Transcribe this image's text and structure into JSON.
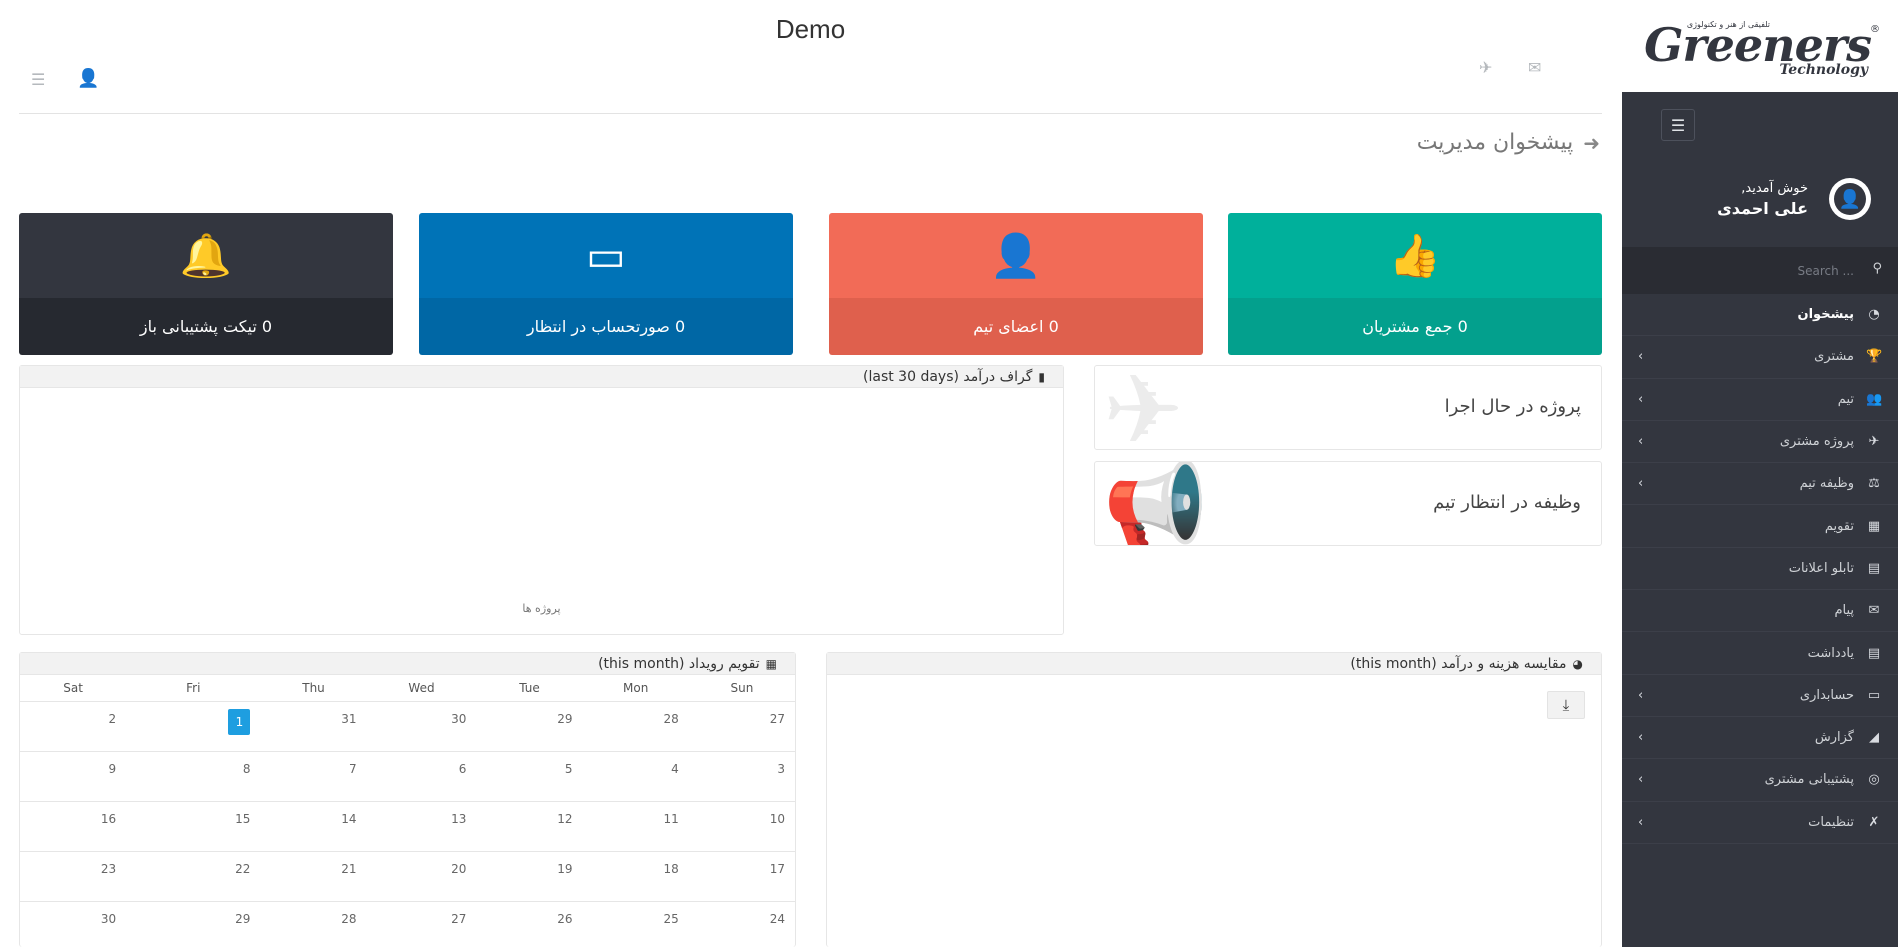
{
  "header": {
    "title": "Demo",
    "page_heading": "پیشخوان مدیریت"
  },
  "sidebar": {
    "brand": "Greeners",
    "brand_sub": "Technology",
    "brand_tagline": "تلفیقی از هنر و تکنولوژی",
    "brand_mark": "®",
    "welcome": "خوش آمدید,",
    "user_name": "علی احمدی",
    "search_placeholder": "Search ...",
    "items": [
      {
        "label": "پیشخوان",
        "icon": "dashboard-icon",
        "glyph": "◔",
        "chevron": false,
        "active": true
      },
      {
        "label": "مشتری",
        "icon": "trophy-icon",
        "glyph": "🏆",
        "chevron": true
      },
      {
        "label": "تیم",
        "icon": "users-icon",
        "glyph": "👥",
        "chevron": true
      },
      {
        "label": "پروژه مشتری",
        "icon": "paper-plane-icon",
        "glyph": "✈",
        "chevron": true
      },
      {
        "label": "وظیفه تیم",
        "icon": "task-icon",
        "glyph": "⚖",
        "chevron": true
      },
      {
        "label": "تقویم",
        "icon": "calendar-icon",
        "glyph": "▦",
        "chevron": false
      },
      {
        "label": "تابلو اعلانات",
        "icon": "notice-board-icon",
        "glyph": "▤",
        "chevron": false
      },
      {
        "label": "پیام",
        "icon": "envelope-icon",
        "glyph": "✉",
        "chevron": false
      },
      {
        "label": "یادداشت",
        "icon": "note-icon",
        "glyph": "▤",
        "chevron": false
      },
      {
        "label": "حسابداری",
        "icon": "credit-card-icon",
        "glyph": "▭",
        "chevron": true
      },
      {
        "label": "گزارش",
        "icon": "area-chart-icon",
        "glyph": "◢",
        "chevron": true
      },
      {
        "label": "پشتیبانی مشتری",
        "icon": "globe-icon",
        "glyph": "◎",
        "chevron": true
      },
      {
        "label": "تنظیمات",
        "icon": "tools-icon",
        "glyph": "✗",
        "chevron": true
      }
    ]
  },
  "stats": [
    {
      "value": "0",
      "label": "جمع مشتریان",
      "icon": "thumbs-up-icon",
      "glyph": "👍",
      "top": "#00b09b",
      "bottom": "#03a08d"
    },
    {
      "value": "0",
      "label": "اعضای تیم",
      "icon": "user-icon",
      "glyph": "👤",
      "top": "#f26b57",
      "bottom": "#df604d"
    },
    {
      "value": "0",
      "label": "صورتحساب در انتظار",
      "icon": "credit-card-icon",
      "glyph": "▭",
      "top": "#0073b7",
      "bottom": "#0067a5"
    },
    {
      "value": "0",
      "label": "تیکت پشتیبانی باز",
      "icon": "bell-icon",
      "glyph": "🔔",
      "top": "#33363f",
      "bottom": "#262930"
    }
  ],
  "revenue_chart": {
    "title": "گراف درآمد (last 30 days)",
    "xlabel": "پروژه ها"
  },
  "info_boxes": [
    {
      "label": "پروژه در حال اجرا",
      "icon": "paper-plane-icon"
    },
    {
      "label": "وظیفه در انتظار تیم",
      "icon": "bullhorn-icon"
    }
  ],
  "calendar": {
    "title": "تقویم رویداد (this month)",
    "weekdays": [
      "Sun",
      "Mon",
      "Tue",
      "Wed",
      "Thu",
      "Fri",
      "Sat"
    ],
    "weeks": [
      [
        "27",
        "28",
        "29",
        "30",
        "31",
        "1",
        "2"
      ],
      [
        "3",
        "4",
        "5",
        "6",
        "7",
        "8",
        "9"
      ],
      [
        "10",
        "11",
        "12",
        "13",
        "14",
        "15",
        "16"
      ],
      [
        "17",
        "18",
        "19",
        "20",
        "21",
        "22",
        "23"
      ],
      [
        "24",
        "25",
        "26",
        "27",
        "28",
        "29",
        "30"
      ]
    ],
    "today": "1"
  },
  "expense_panel": {
    "title": "مقایسه هزینه و درآمد (this month)"
  },
  "colors": {
    "sidebar_bg": "#33363f",
    "accent_blue": "#1e9ee0"
  }
}
